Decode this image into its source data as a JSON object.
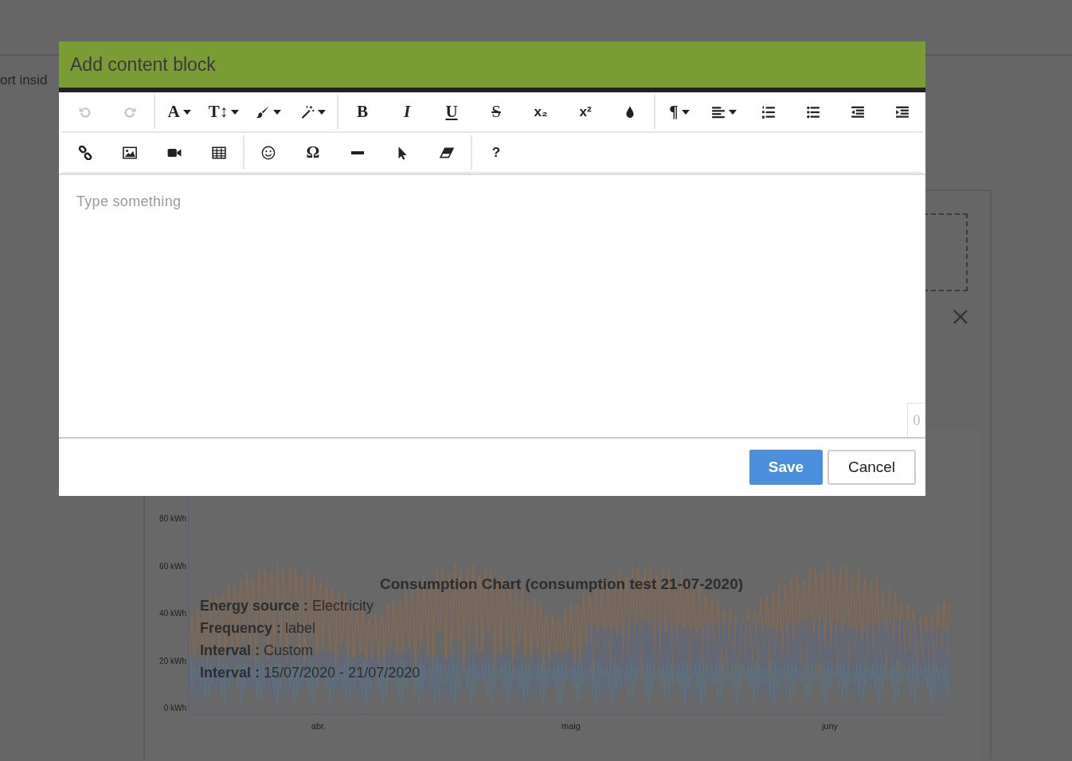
{
  "background_page": {
    "partial_text": "ort insid",
    "chart": {
      "title": "Consumption Chart (consumption test 21-07-2020)",
      "y_labels": [
        "80 kWh",
        "60 kWh",
        "40 kWh",
        "20 kWh",
        "0 kWh"
      ],
      "x_labels": [
        "abr.",
        "maig",
        "juny"
      ],
      "info": [
        "**Energy source :** Electricity",
        "**Frequency :** label",
        "**Interval :** Custom",
        "**Interval :** 15/07/2020 - 21/07/2020"
      ]
    }
  },
  "dialog": {
    "title": "Add content block",
    "toolbar": [
      [
        [
          {
            "kind": "undo",
            "disabled": true,
            "dropdown": false
          },
          {
            "kind": "redo",
            "disabled": true,
            "dropdown": false
          }
        ],
        [
          {
            "kind": "fontcolor",
            "glyph": "A",
            "disabled": false,
            "dropdown": true
          },
          {
            "kind": "fontsize",
            "glyph": "T↕",
            "disabled": false,
            "dropdown": true
          },
          {
            "kind": "brush",
            "disabled": false,
            "dropdown": true
          },
          {
            "kind": "wand",
            "disabled": false,
            "dropdown": true
          }
        ],
        [
          {
            "kind": "bold",
            "glyph": "B",
            "disabled": false,
            "dropdown": false
          },
          {
            "kind": "italic",
            "glyph": "I",
            "disabled": false,
            "dropdown": false
          },
          {
            "kind": "underline",
            "glyph": "U",
            "disabled": false,
            "dropdown": false
          },
          {
            "kind": "strike",
            "glyph": "S",
            "disabled": false,
            "dropdown": false
          },
          {
            "kind": "subscript",
            "glyph": "x₂",
            "disabled": false,
            "dropdown": false
          },
          {
            "kind": "superscript",
            "glyph": "x²",
            "disabled": false,
            "dropdown": false
          },
          {
            "kind": "drop",
            "disabled": false,
            "dropdown": false
          }
        ],
        [
          {
            "kind": "paragraph",
            "glyph": "¶",
            "disabled": false,
            "dropdown": true
          },
          {
            "kind": "align",
            "disabled": false,
            "dropdown": true
          },
          {
            "kind": "olist",
            "disabled": false,
            "dropdown": false
          },
          {
            "kind": "ulist",
            "disabled": false,
            "dropdown": false
          },
          {
            "kind": "outdent",
            "disabled": false,
            "dropdown": false
          },
          {
            "kind": "indent",
            "disabled": false,
            "dropdown": false
          }
        ]
      ],
      [
        [
          {
            "kind": "link",
            "disabled": false,
            "dropdown": false
          },
          {
            "kind": "image",
            "disabled": false,
            "dropdown": false
          },
          {
            "kind": "video",
            "disabled": false,
            "dropdown": false
          },
          {
            "kind": "table",
            "disabled": false,
            "dropdown": false
          }
        ],
        [
          {
            "kind": "emoji",
            "disabled": false,
            "dropdown": false
          },
          {
            "kind": "symbol",
            "glyph": "Ω",
            "disabled": false,
            "dropdown": false
          },
          {
            "kind": "rule",
            "disabled": false,
            "dropdown": false
          },
          {
            "kind": "cursor",
            "disabled": false,
            "dropdown": false
          },
          {
            "kind": "eraser",
            "disabled": false,
            "dropdown": false
          }
        ],
        [
          {
            "kind": "help",
            "glyph": "?",
            "disabled": false,
            "dropdown": false
          }
        ]
      ]
    ],
    "editor": {
      "placeholder": "Type something",
      "char_count": "0"
    },
    "buttons": [
      {
        "label": "Save",
        "kind": "primary"
      },
      {
        "label": "Cancel",
        "kind": "secondary"
      }
    ]
  }
}
